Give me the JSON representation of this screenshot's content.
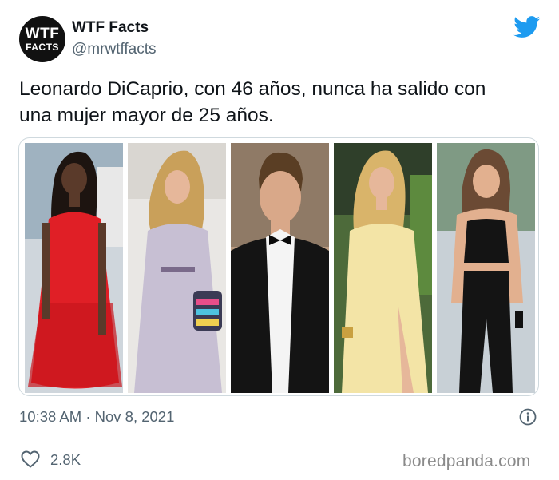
{
  "author": {
    "avatar_line1": "WTF",
    "avatar_line2": "FACTS",
    "display_name": "WTF Facts",
    "handle": "@mrwtffacts"
  },
  "tweet": {
    "text_line1": "Leonardo DiCaprio, con 46 años, nunca ha salido con",
    "text_line2": "una mujer mayor de 25 años.",
    "time": "10:38 AM",
    "separator": "·",
    "date": "Nov 8, 2021",
    "likes": "2.8K"
  },
  "media": {
    "photos": [
      {
        "name": "woman in red fringe dress"
      },
      {
        "name": "woman in lilac dress with bag"
      },
      {
        "name": "man in black tuxedo"
      },
      {
        "name": "woman in yellow satin gown"
      },
      {
        "name": "woman in black top and pants"
      }
    ]
  },
  "icons": {
    "brand": "twitter-bird-icon",
    "info": "info-icon",
    "like": "heart-icon"
  },
  "watermark": "boredpanda.com",
  "colors": {
    "twitter_blue": "#1d9bf0",
    "secondary_text": "#536471",
    "border": "#cfd9de"
  }
}
